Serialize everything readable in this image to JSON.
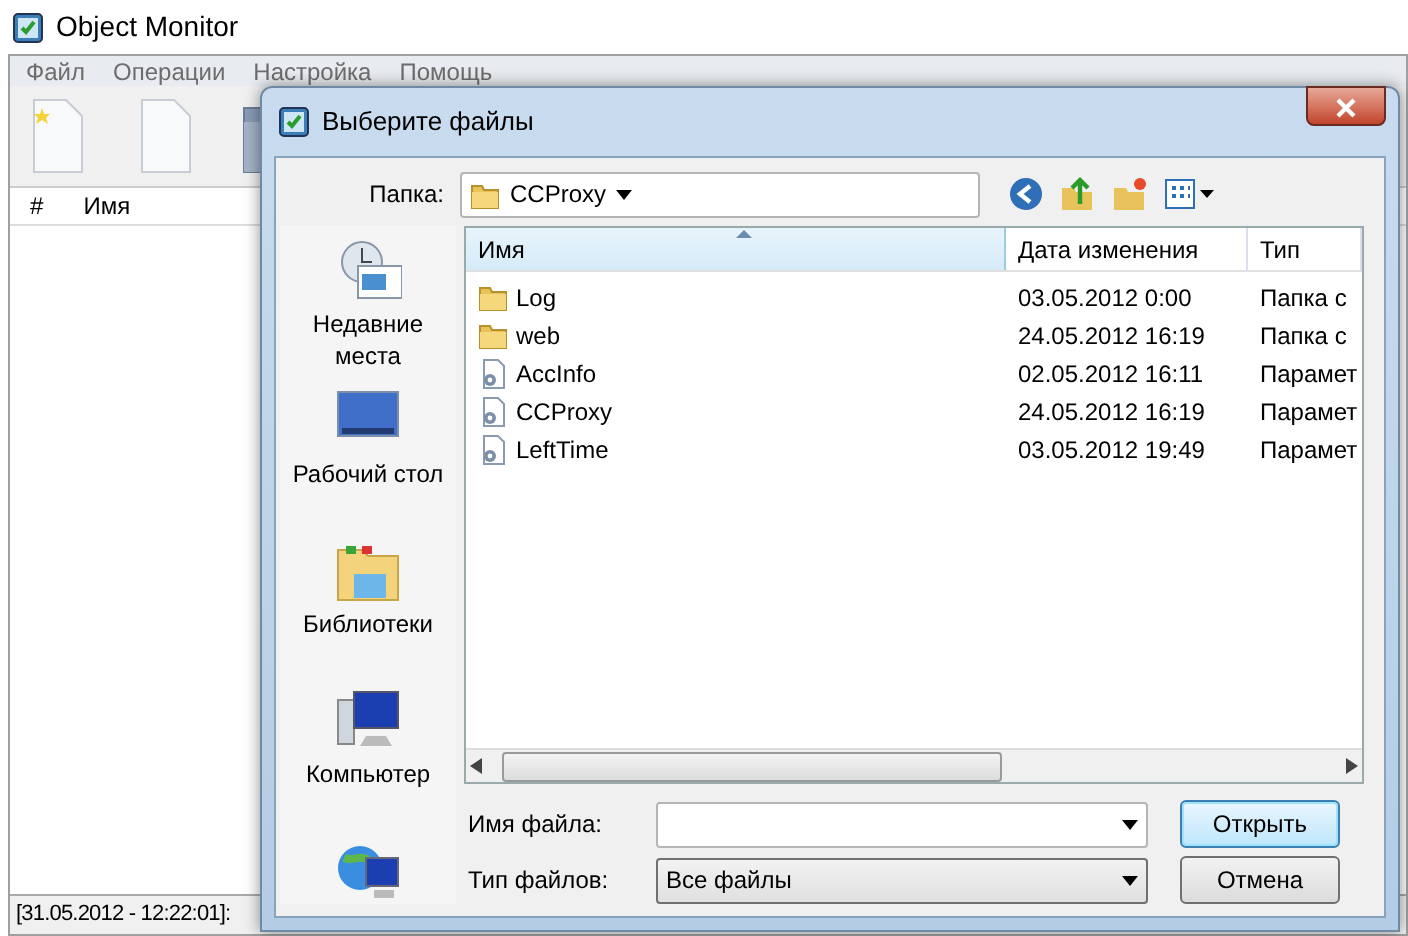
{
  "app": {
    "title": "Object Monitor",
    "menu": [
      "Файл",
      "Операции",
      "Настройка",
      "Помощь"
    ],
    "toolbar": [
      {
        "kind": "new"
      },
      {
        "kind": "document"
      },
      {
        "kind": "folder"
      }
    ],
    "list_columns": [
      "#",
      "Имя"
    ],
    "status_bar": "[31.05.2012 - 12:22:01]:"
  },
  "dialog": {
    "title": "Выберите файлы",
    "folder_label": "Папка:",
    "folder": "CCProxy",
    "places": [
      {
        "kind": "recent",
        "label": "Недавние места"
      },
      {
        "kind": "desktop",
        "label": "Рабочий стол"
      },
      {
        "kind": "libraries",
        "label": "Библиотеки"
      },
      {
        "kind": "computer",
        "label": "Компьютер"
      },
      {
        "kind": "network"
      }
    ],
    "columns": [
      {
        "label": "Имя",
        "sorted": true
      },
      {
        "label": "Дата изменения",
        "sorted": false
      },
      {
        "label": "Тип",
        "sorted": false
      }
    ],
    "files": [
      {
        "kind": "folder",
        "name": "Log",
        "date": "03.05.2012 0:00",
        "type": "Папка с"
      },
      {
        "kind": "folder",
        "name": "web",
        "date": "24.05.2012 16:19",
        "type": "Папка с"
      },
      {
        "kind": "settings",
        "name": "AccInfo",
        "date": "02.05.2012 16:11",
        "type": "Парамет"
      },
      {
        "kind": "settings",
        "name": "CCProxy",
        "date": "24.05.2012 16:19",
        "type": "Парамет"
      },
      {
        "kind": "settings",
        "name": "LeftTime",
        "date": "03.05.2012 19:49",
        "type": "Парамет"
      }
    ],
    "file_name_label": "Имя файла:",
    "file_type_label": "Тип файлов:",
    "file_type": "Все файлы",
    "buttons": [
      {
        "label": "Открыть",
        "default": true
      },
      {
        "label": "Отмена",
        "default": false
      }
    ]
  }
}
